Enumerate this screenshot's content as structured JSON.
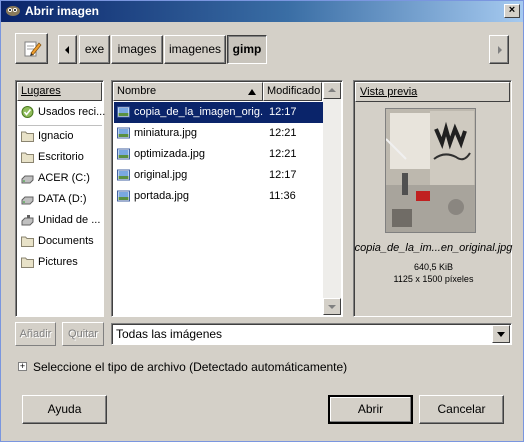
{
  "window": {
    "title": "Abrir imagen"
  },
  "path_bar": {
    "crumbs": [
      "exe",
      "images",
      "imagenes",
      "gimp"
    ],
    "active_crumb": "gimp"
  },
  "places": {
    "header": "Lugares",
    "items": [
      {
        "label": "Usados reci...",
        "icon": "recent-icon"
      },
      {
        "label": "Ignacio",
        "icon": "folder-icon"
      },
      {
        "label": "Escritorio",
        "icon": "folder-icon"
      },
      {
        "label": "ACER (C:)",
        "icon": "drive-icon"
      },
      {
        "label": "DATA (D:)",
        "icon": "drive-icon"
      },
      {
        "label": "Unidad de ...",
        "icon": "drive-icon"
      },
      {
        "label": "Documents",
        "icon": "folder-icon"
      },
      {
        "label": "Pictures",
        "icon": "folder-icon"
      }
    ]
  },
  "files": {
    "col_name": "Nombre",
    "col_modified": "Modificado",
    "rows": [
      {
        "name": "copia_de_la_imagen_orig...",
        "time": "12:17",
        "selected": true
      },
      {
        "name": "miniatura.jpg",
        "time": "12:21",
        "selected": false
      },
      {
        "name": "optimizada.jpg",
        "time": "12:21",
        "selected": false
      },
      {
        "name": "original.jpg",
        "time": "12:17",
        "selected": false
      },
      {
        "name": "portada.jpg",
        "time": "11:36",
        "selected": false
      }
    ]
  },
  "preview": {
    "title": "Vista previa",
    "filename": "copia_de_la_im...en_original.jpg",
    "size": "640,5 KiB",
    "dimensions": "1125 x 1500 píxeles"
  },
  "actions": {
    "add": "Añadir",
    "remove": "Quitar",
    "filter": "Todas las imágenes"
  },
  "file_type": {
    "expander": "+",
    "label": "Seleccione el tipo de archivo (Detectado automáticamente)"
  },
  "buttons": {
    "help": "Ayuda",
    "open": "Abrir",
    "cancel": "Cancelar"
  },
  "colors": {
    "selection": "#0a246a",
    "titlebar_start": "#0a246a",
    "titlebar_end": "#a6caf0",
    "face": "#d4d0c8"
  }
}
